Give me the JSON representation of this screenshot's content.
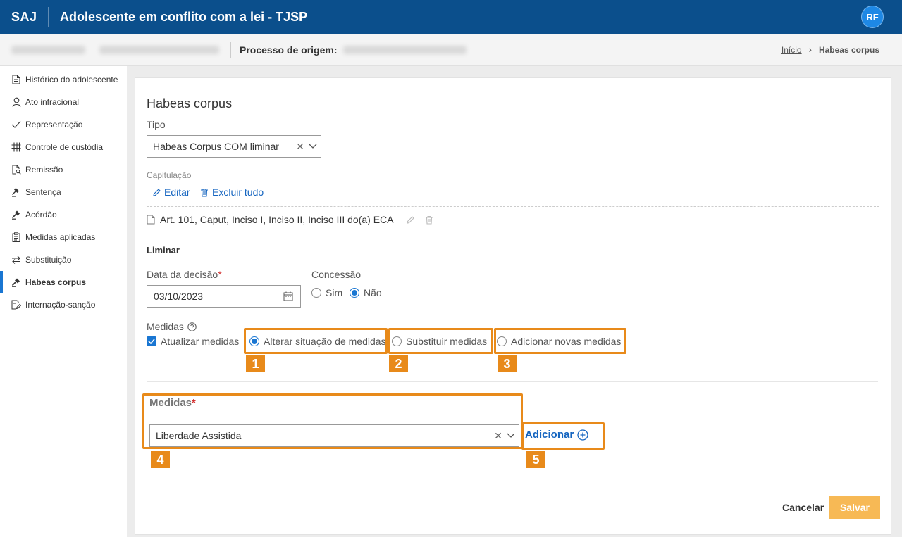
{
  "topbar": {
    "brand": "SAJ",
    "title": "Adolescente em conflito com a lei - TJSP",
    "avatar": "RF"
  },
  "subbar": {
    "process_label": "Processo de origem:",
    "breadcrumb_home": "Início",
    "breadcrumb_current": "Habeas corpus"
  },
  "sidebar": {
    "items": [
      {
        "label": "Histórico do adolescente",
        "icon": "document-icon"
      },
      {
        "label": "Ato infracional",
        "icon": "person-icon"
      },
      {
        "label": "Representação",
        "icon": "check-icon"
      },
      {
        "label": "Controle de custódia",
        "icon": "grid-icon"
      },
      {
        "label": "Remissão",
        "icon": "document-search-icon"
      },
      {
        "label": "Sentença",
        "icon": "gavel-icon"
      },
      {
        "label": "Acórdão",
        "icon": "gavel-filled-icon"
      },
      {
        "label": "Medidas aplicadas",
        "icon": "clipboard-icon"
      },
      {
        "label": "Substituição",
        "icon": "swap-icon"
      },
      {
        "label": "Habeas corpus",
        "icon": "gavel-filled-icon",
        "active": true
      },
      {
        "label": "Internação-sanção",
        "icon": "document-edit-icon"
      }
    ]
  },
  "form": {
    "title": "Habeas corpus",
    "tipo_label": "Tipo",
    "tipo_value": "Habeas Corpus COM liminar",
    "capitulacao_label": "Capitulação",
    "editar": "Editar",
    "excluir_tudo": "Excluir tudo",
    "article": "Art. 101, Caput, Inciso I, Inciso II, Inciso III do(a) ECA",
    "liminar": "Liminar",
    "data_label": "Data da decisão",
    "required_mark": "*",
    "data_value": "03/10/2023",
    "concessao_label": "Concessão",
    "sim": "Sim",
    "nao": "Não",
    "medidas_label": "Medidas",
    "atualizar": "Atualizar medidas",
    "opt1": "Alterar situação de medidas",
    "opt2": "Substituir medidas",
    "opt3": "Adicionar novas medidas",
    "medidas_field_label": "Medidas",
    "medidas_value": "Liberdade Assistida",
    "adicionar": "Adicionar",
    "cancelar": "Cancelar",
    "salvar": "Salvar"
  },
  "badges": [
    "1",
    "2",
    "3",
    "4",
    "5"
  ],
  "colors": {
    "topbar": "#0b4f8c",
    "accent": "#1976d2",
    "highlight": "#e88a1a",
    "save": "#f7b955"
  }
}
